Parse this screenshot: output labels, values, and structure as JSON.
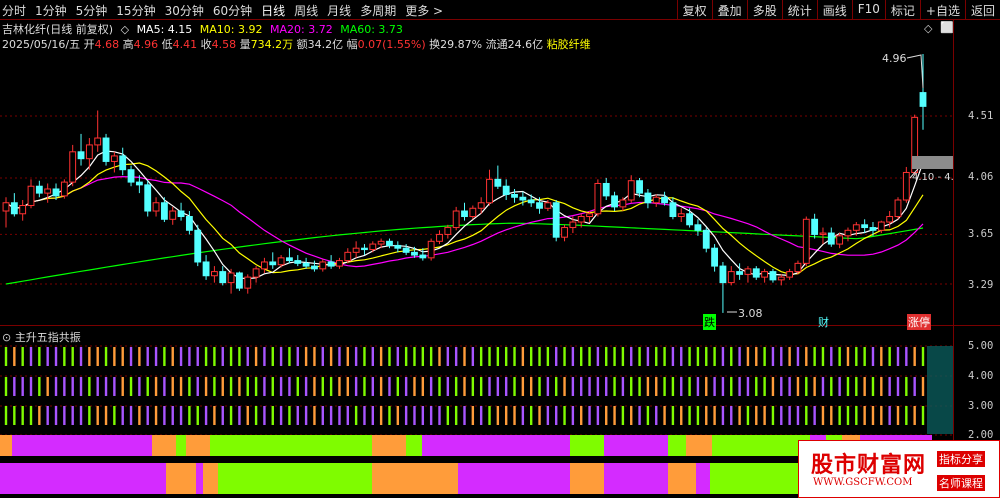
{
  "toolbar": {
    "periods": [
      "分时",
      "1分钟",
      "5分钟",
      "15分钟",
      "30分钟",
      "60分钟",
      "日线",
      "周线",
      "月线",
      "多周期",
      "更多"
    ],
    "more_arrow": ">",
    "actions": [
      "复权",
      "叠加",
      "多股",
      "统计",
      "画线",
      "F10",
      "标记",
      "+自选",
      "返回"
    ]
  },
  "header": {
    "stock": "吉林化纤(日线 前复权)",
    "toggle": "◇",
    "ma5": "MA5: 4.15",
    "ma10": "MA10: 3.92",
    "ma20": "MA20: 3.72",
    "ma60": "MA60: 3.73",
    "date": "2025/05/16/五",
    "open_lbl": "开",
    "open": "4.68",
    "high_lbl": "高",
    "high": "4.96",
    "low_lbl": "低",
    "low": "4.41",
    "close_lbl": "收",
    "close": "4.58",
    "vol_lbl": "量",
    "vol": "734.2万",
    "amt_lbl": "额",
    "amt": "34.2亿",
    "chg_lbl": "幅",
    "chg": "0.07(1.55%)",
    "turn_lbl": "换",
    "turn": "29.87%",
    "float_lbl": "流通",
    "float": "24.6亿",
    "industry": "粘胶纤维",
    "corner_icons": [
      "◇",
      "⬜"
    ]
  },
  "price_axis": [
    "4.51",
    "4.06",
    "3.65",
    "3.29"
  ],
  "annotations": {
    "high_label": "4.96",
    "low_label": "3.08",
    "range_label": "4.10 - 4.",
    "tag_die": "跌",
    "tag_cai": "财",
    "tag_zhangting": "涨停"
  },
  "indicator": {
    "title": "主升五指共振",
    "axis": [
      "5.00",
      "4.00",
      "3.00",
      "2.00"
    ]
  },
  "colors": {
    "up": "#ff3232",
    "down": "#54ffff",
    "ma5": "#ffffff",
    "ma10": "#ffff00",
    "ma20": "#ff00ff",
    "ma60": "#00ff00",
    "grid": "#7a0000",
    "ind_green": "#7ffc00",
    "ind_purple": "#d42bff",
    "ind_orange": "#ff9c3a",
    "ind_purple2": "#a855ff"
  },
  "watermark": {
    "brand": "股市财富网",
    "url": "WWW.GSCFW.COM",
    "tag1": "指标分享",
    "tag2": "名师课程"
  },
  "chart_data": {
    "type": "candlestick",
    "title": "吉林化纤(日线 前复权)",
    "y_ticks": [
      3.29,
      3.65,
      4.06,
      4.51
    ],
    "last_bar": {
      "date": "2025/05/16",
      "open": 4.68,
      "high": 4.96,
      "low": 4.41,
      "close": 4.58
    },
    "ma": {
      "MA5": 4.15,
      "MA10": 3.92,
      "MA20": 3.72,
      "MA60": 3.73
    },
    "candles": [
      [
        3.82,
        3.92,
        3.7,
        3.88
      ],
      [
        3.88,
        3.95,
        3.78,
        3.8
      ],
      [
        3.8,
        3.9,
        3.75,
        3.86
      ],
      [
        3.86,
        4.05,
        3.84,
        4.0
      ],
      [
        4.0,
        4.04,
        3.92,
        3.95
      ],
      [
        3.95,
        4.02,
        3.88,
        3.98
      ],
      [
        3.98,
        4.02,
        3.9,
        3.93
      ],
      [
        3.93,
        4.05,
        3.91,
        4.03
      ],
      [
        4.03,
        4.3,
        4.0,
        4.25
      ],
      [
        4.25,
        4.38,
        4.15,
        4.2
      ],
      [
        4.2,
        4.35,
        4.12,
        4.3
      ],
      [
        4.3,
        4.55,
        4.25,
        4.35
      ],
      [
        4.35,
        4.38,
        4.15,
        4.18
      ],
      [
        4.18,
        4.25,
        4.1,
        4.22
      ],
      [
        4.22,
        4.28,
        4.08,
        4.12
      ],
      [
        4.12,
        4.15,
        4.0,
        4.03
      ],
      [
        4.03,
        4.08,
        3.95,
        4.01
      ],
      [
        4.01,
        4.04,
        3.78,
        3.82
      ],
      [
        3.82,
        3.92,
        3.78,
        3.88
      ],
      [
        3.88,
        3.92,
        3.74,
        3.76
      ],
      [
        3.76,
        3.85,
        3.72,
        3.82
      ],
      [
        3.82,
        3.88,
        3.75,
        3.78
      ],
      [
        3.78,
        3.82,
        3.65,
        3.68
      ],
      [
        3.68,
        3.72,
        3.42,
        3.45
      ],
      [
        3.45,
        3.5,
        3.32,
        3.35
      ],
      [
        3.35,
        3.42,
        3.3,
        3.38
      ],
      [
        3.38,
        3.42,
        3.28,
        3.3
      ],
      [
        3.3,
        3.4,
        3.22,
        3.37
      ],
      [
        3.37,
        3.38,
        3.24,
        3.26
      ],
      [
        3.26,
        3.36,
        3.22,
        3.34
      ],
      [
        3.34,
        3.42,
        3.3,
        3.4
      ],
      [
        3.4,
        3.48,
        3.37,
        3.45
      ],
      [
        3.45,
        3.52,
        3.4,
        3.43
      ],
      [
        3.43,
        3.5,
        3.41,
        3.48
      ],
      [
        3.48,
        3.55,
        3.44,
        3.46
      ],
      [
        3.46,
        3.5,
        3.42,
        3.44
      ],
      [
        3.44,
        3.48,
        3.4,
        3.42
      ],
      [
        3.42,
        3.46,
        3.38,
        3.4
      ],
      [
        3.4,
        3.47,
        3.38,
        3.45
      ],
      [
        3.45,
        3.5,
        3.4,
        3.42
      ],
      [
        3.42,
        3.48,
        3.4,
        3.46
      ],
      [
        3.46,
        3.55,
        3.44,
        3.52
      ],
      [
        3.52,
        3.6,
        3.48,
        3.55
      ],
      [
        3.55,
        3.58,
        3.5,
        3.54
      ],
      [
        3.54,
        3.6,
        3.52,
        3.58
      ],
      [
        3.58,
        3.62,
        3.55,
        3.6
      ],
      [
        3.6,
        3.62,
        3.55,
        3.57
      ],
      [
        3.57,
        3.6,
        3.52,
        3.55
      ],
      [
        3.55,
        3.58,
        3.5,
        3.52
      ],
      [
        3.52,
        3.56,
        3.48,
        3.5
      ],
      [
        3.5,
        3.55,
        3.46,
        3.48
      ],
      [
        3.48,
        3.62,
        3.46,
        3.6
      ],
      [
        3.6,
        3.68,
        3.58,
        3.65
      ],
      [
        3.65,
        3.72,
        3.62,
        3.7
      ],
      [
        3.7,
        3.85,
        3.68,
        3.82
      ],
      [
        3.82,
        3.88,
        3.75,
        3.78
      ],
      [
        3.78,
        3.86,
        3.76,
        3.84
      ],
      [
        3.84,
        3.92,
        3.8,
        3.88
      ],
      [
        3.88,
        4.12,
        3.86,
        4.05
      ],
      [
        4.05,
        4.15,
        3.98,
        4.0
      ],
      [
        4.0,
        4.05,
        3.9,
        3.94
      ],
      [
        3.94,
        3.98,
        3.88,
        3.92
      ],
      [
        3.92,
        3.96,
        3.86,
        3.9
      ],
      [
        3.9,
        3.94,
        3.85,
        3.88
      ],
      [
        3.88,
        3.92,
        3.8,
        3.84
      ],
      [
        3.84,
        3.9,
        3.82,
        3.88
      ],
      [
        3.88,
        3.9,
        3.6,
        3.63
      ],
      [
        3.63,
        3.72,
        3.6,
        3.7
      ],
      [
        3.7,
        3.78,
        3.66,
        3.74
      ],
      [
        3.74,
        3.8,
        3.7,
        3.78
      ],
      [
        3.78,
        3.82,
        3.74,
        3.8
      ],
      [
        3.8,
        4.05,
        3.78,
        4.02
      ],
      [
        4.02,
        4.06,
        3.9,
        3.93
      ],
      [
        3.93,
        3.96,
        3.82,
        3.85
      ],
      [
        3.85,
        3.92,
        3.82,
        3.9
      ],
      [
        3.9,
        4.08,
        3.88,
        4.04
      ],
      [
        4.04,
        4.06,
        3.92,
        3.95
      ],
      [
        3.95,
        3.98,
        3.84,
        3.88
      ],
      [
        3.88,
        3.94,
        3.85,
        3.92
      ],
      [
        3.92,
        3.96,
        3.86,
        3.88
      ],
      [
        3.88,
        3.92,
        3.76,
        3.78
      ],
      [
        3.78,
        3.84,
        3.74,
        3.8
      ],
      [
        3.8,
        3.84,
        3.7,
        3.72
      ],
      [
        3.72,
        3.76,
        3.64,
        3.68
      ],
      [
        3.68,
        3.7,
        3.52,
        3.55
      ],
      [
        3.55,
        3.58,
        3.38,
        3.42
      ],
      [
        3.42,
        3.45,
        3.08,
        3.3
      ],
      [
        3.3,
        3.42,
        3.28,
        3.38
      ],
      [
        3.38,
        3.44,
        3.32,
        3.36
      ],
      [
        3.36,
        3.42,
        3.3,
        3.4
      ],
      [
        3.4,
        3.42,
        3.32,
        3.34
      ],
      [
        3.34,
        3.4,
        3.3,
        3.38
      ],
      [
        3.38,
        3.4,
        3.3,
        3.32
      ],
      [
        3.32,
        3.36,
        3.28,
        3.34
      ],
      [
        3.34,
        3.4,
        3.32,
        3.38
      ],
      [
        3.38,
        3.46,
        3.36,
        3.44
      ],
      [
        3.44,
        3.78,
        3.42,
        3.76
      ],
      [
        3.76,
        3.8,
        3.62,
        3.65
      ],
      [
        3.65,
        3.7,
        3.58,
        3.66
      ],
      [
        3.66,
        3.7,
        3.56,
        3.58
      ],
      [
        3.58,
        3.66,
        3.55,
        3.64
      ],
      [
        3.64,
        3.7,
        3.6,
        3.68
      ],
      [
        3.68,
        3.74,
        3.64,
        3.72
      ],
      [
        3.72,
        3.76,
        3.66,
        3.7
      ],
      [
        3.7,
        3.74,
        3.64,
        3.68
      ],
      [
        3.68,
        3.75,
        3.66,
        3.74
      ],
      [
        3.74,
        3.82,
        3.7,
        3.78
      ],
      [
        3.78,
        3.92,
        3.76,
        3.9
      ],
      [
        3.9,
        4.14,
        3.88,
        4.1
      ],
      [
        4.1,
        4.52,
        4.08,
        4.5
      ],
      [
        4.68,
        4.96,
        4.41,
        4.58
      ]
    ]
  }
}
